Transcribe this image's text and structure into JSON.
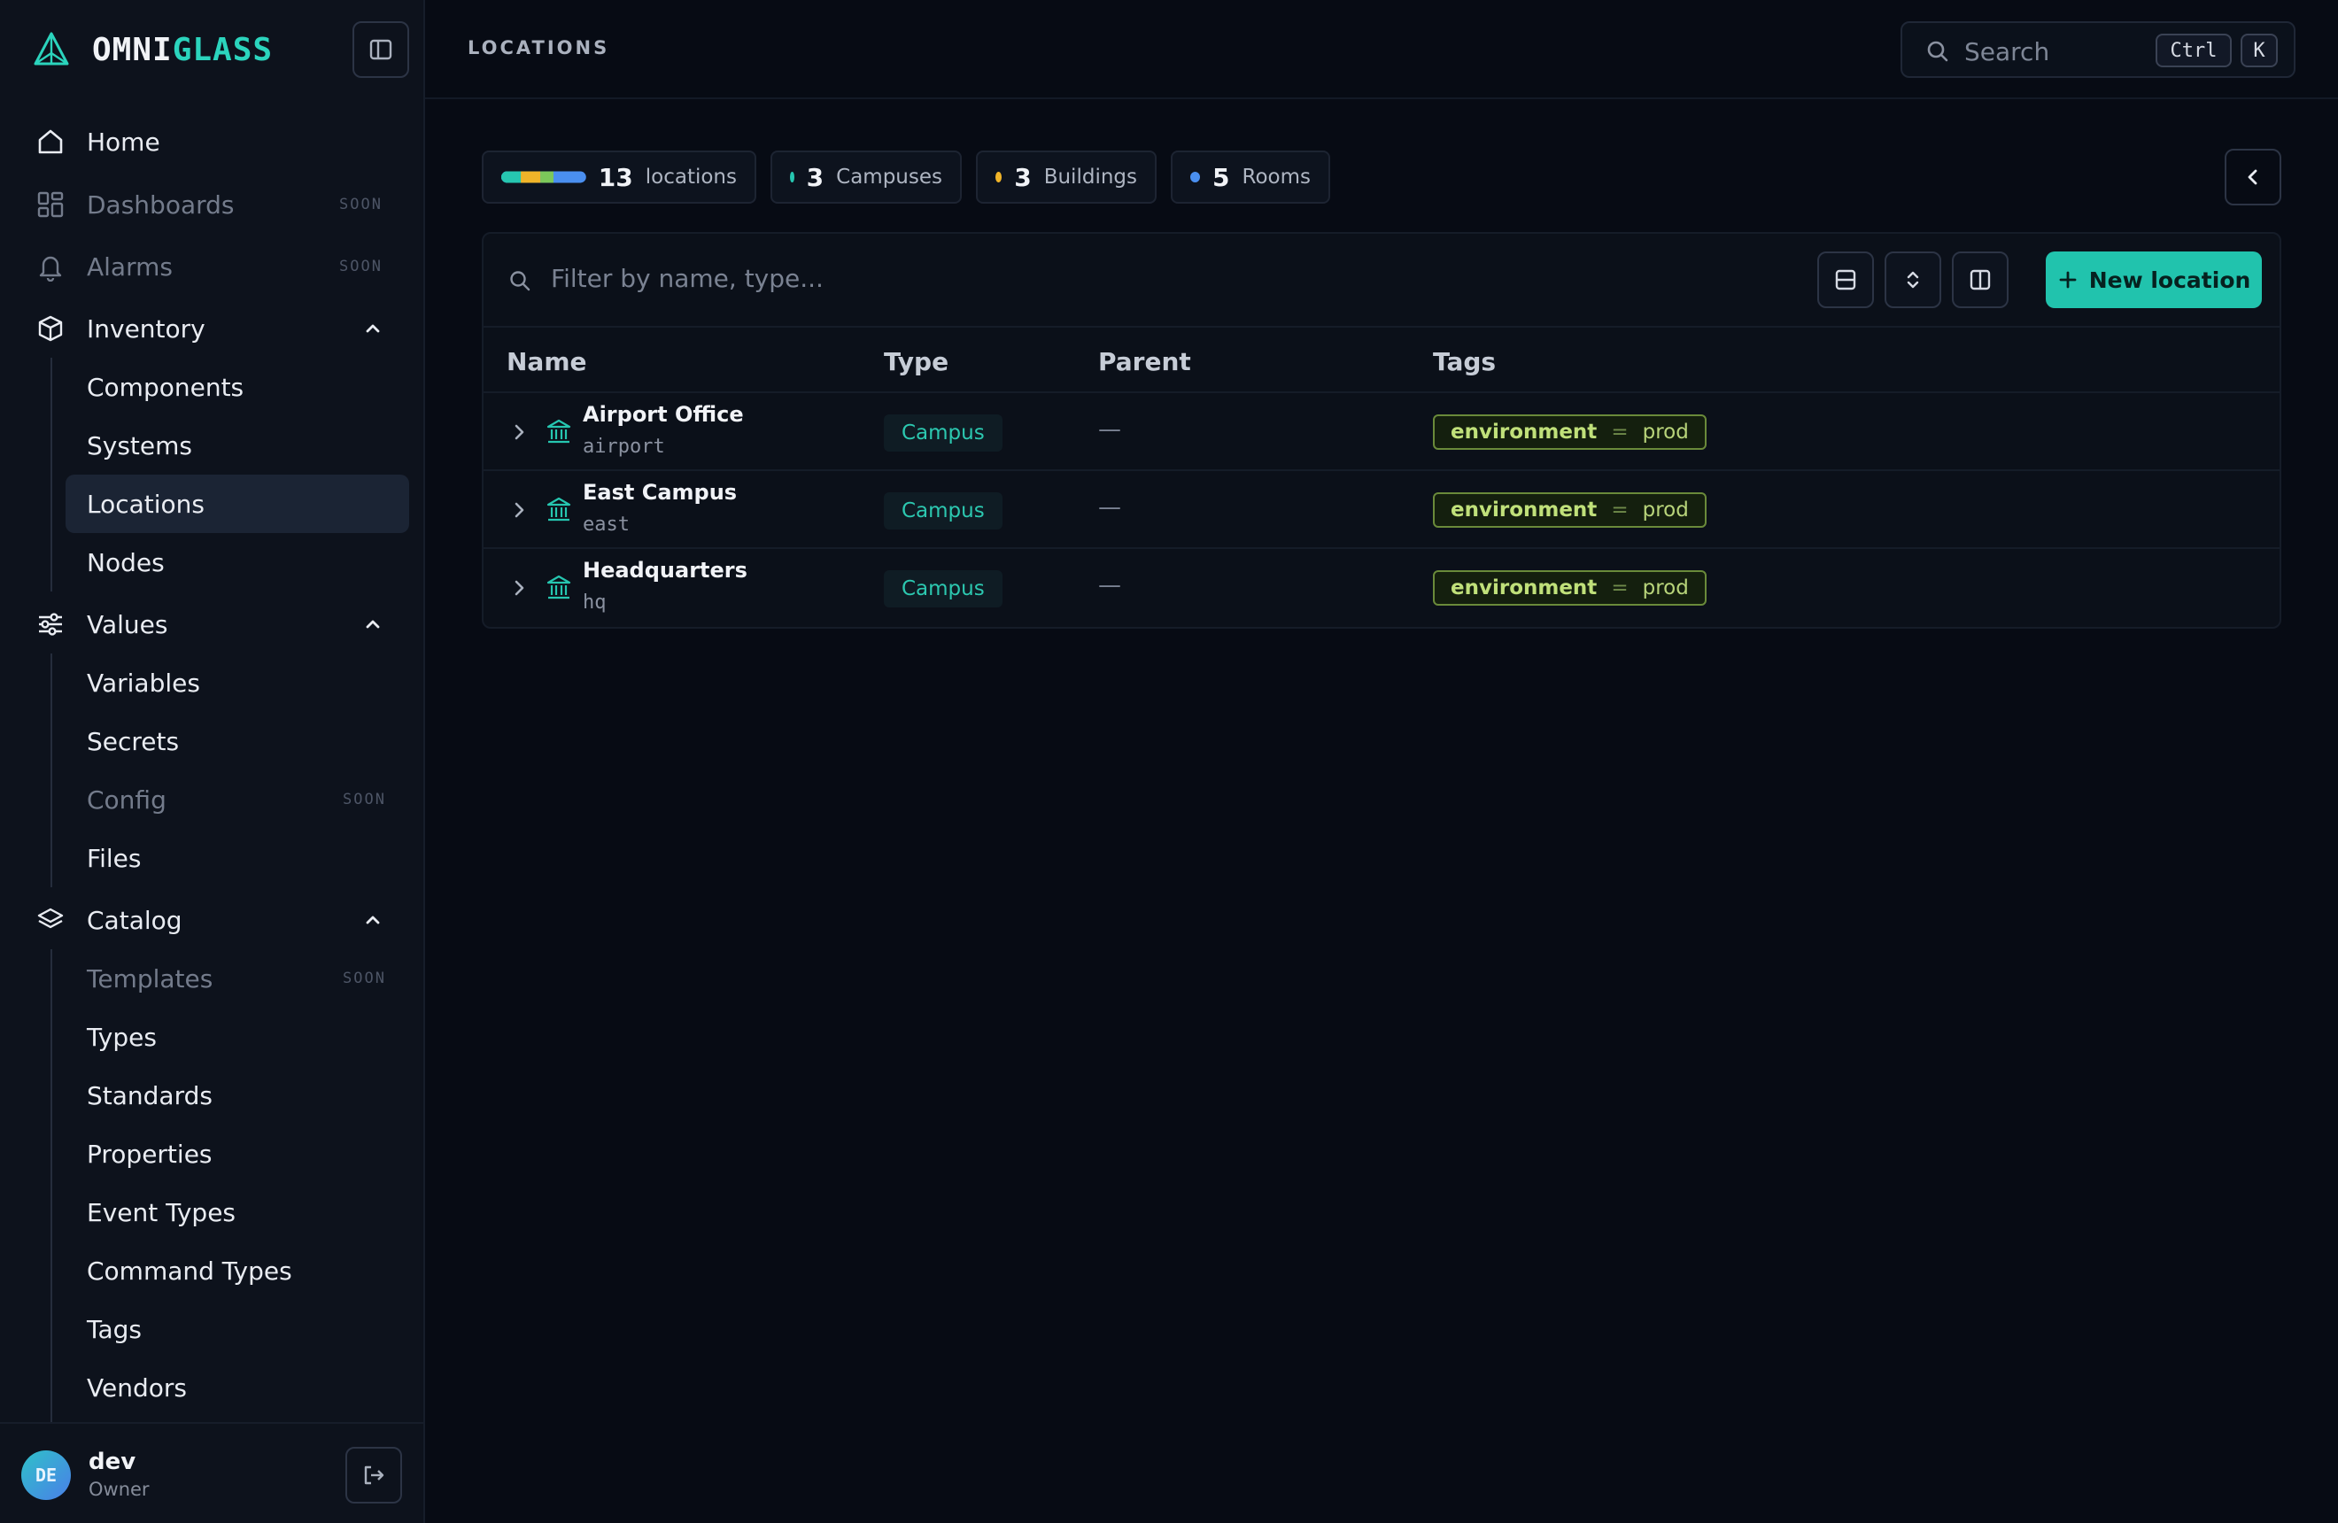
{
  "brand": {
    "part1": "OMNI",
    "part2": "GLASS",
    "color_primary": "#2bd4bd"
  },
  "nav": {
    "home": "Home",
    "dashboards": "Dashboards",
    "alarms": "Alarms",
    "soon_label": "SOON",
    "inventory": {
      "label": "Inventory",
      "items": [
        "Components",
        "Systems",
        "Locations",
        "Nodes"
      ]
    },
    "values": {
      "label": "Values",
      "items": [
        "Variables",
        "Secrets",
        "Config",
        "Files"
      ]
    },
    "catalog": {
      "label": "Catalog",
      "items": [
        "Templates",
        "Types",
        "Standards",
        "Properties",
        "Event Types",
        "Command Types",
        "Tags",
        "Vendors"
      ]
    }
  },
  "user": {
    "initials": "DE",
    "name": "dev",
    "role": "Owner"
  },
  "header": {
    "breadcrumb": "LOCATIONS",
    "search_placeholder": "Search",
    "shortcut_ctrl": "Ctrl",
    "shortcut_key": "K"
  },
  "stats": {
    "total": {
      "count": "13",
      "label": "locations"
    },
    "campuses": {
      "count": "3",
      "label": "Campuses",
      "color": "#26c6b0"
    },
    "buildings": {
      "count": "3",
      "label": "Buildings",
      "color": "#f0b429"
    },
    "rooms": {
      "count": "5",
      "label": "Rooms",
      "color": "#4a8ff0"
    }
  },
  "table": {
    "filter_placeholder": "Filter by name, type...",
    "new_button": "New location",
    "columns": [
      "Name",
      "Type",
      "Parent",
      "Tags"
    ],
    "rows": [
      {
        "name": "Airport Office",
        "slug": "airport",
        "type": "Campus",
        "parent": "—",
        "tag_key": "environment",
        "tag_eq": "=",
        "tag_value": "prod"
      },
      {
        "name": "East Campus",
        "slug": "east",
        "type": "Campus",
        "parent": "—",
        "tag_key": "environment",
        "tag_eq": "=",
        "tag_value": "prod"
      },
      {
        "name": "Headquarters",
        "slug": "hq",
        "type": "Campus",
        "parent": "—",
        "tag_key": "environment",
        "tag_eq": "=",
        "tag_value": "prod"
      }
    ]
  }
}
